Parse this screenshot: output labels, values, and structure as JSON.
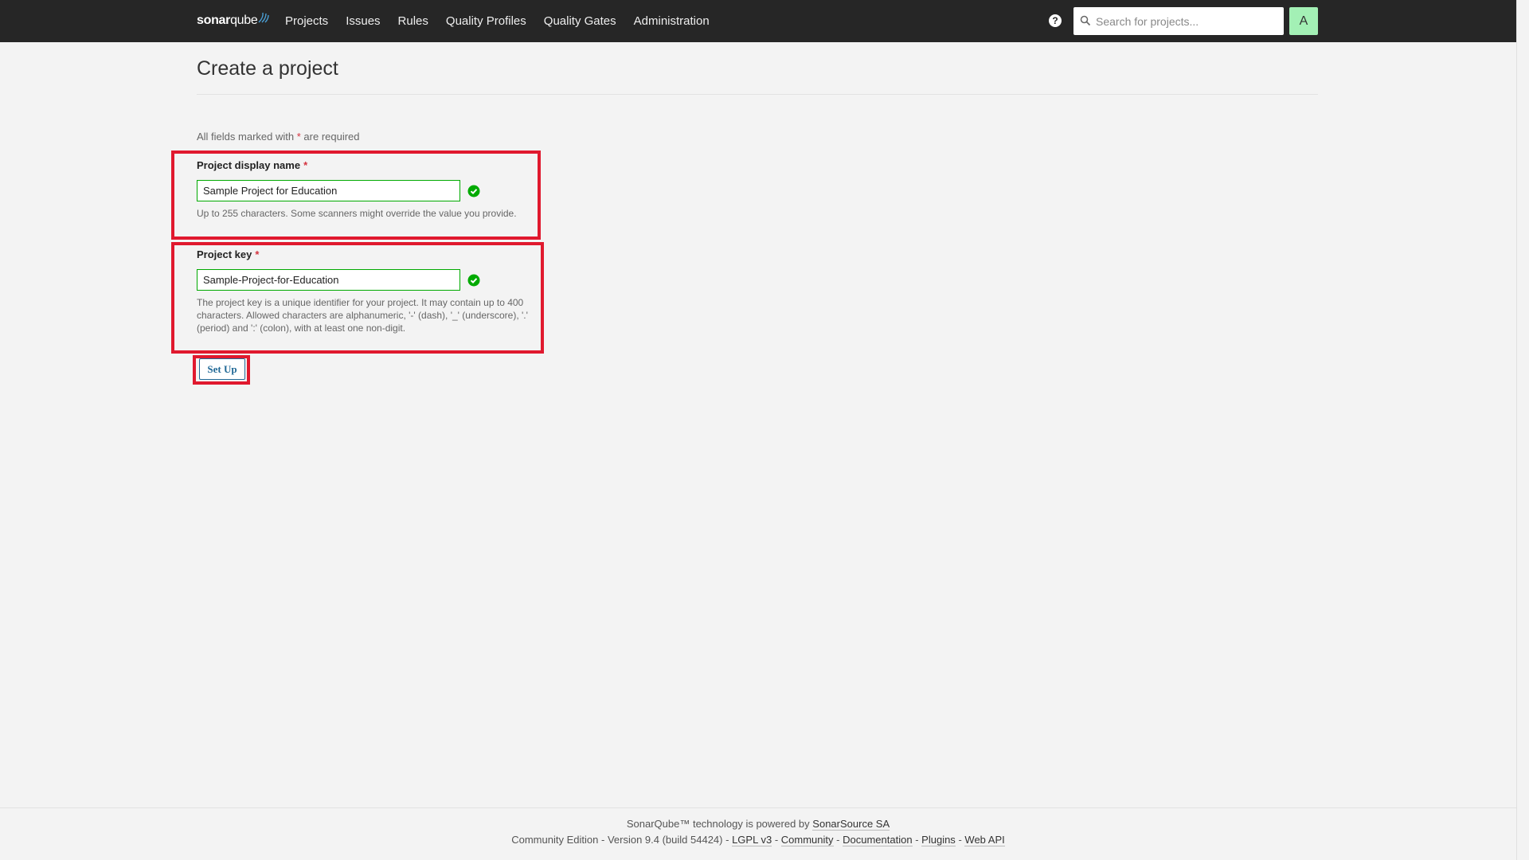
{
  "header": {
    "logo": {
      "bold": "sonar",
      "regular": "qube"
    },
    "nav": [
      "Projects",
      "Issues",
      "Rules",
      "Quality Profiles",
      "Quality Gates",
      "Administration"
    ],
    "help_glyph": "?",
    "search_placeholder": "Search for projects...",
    "avatar_letter": "A",
    "avatar_color": "#a3f0b5"
  },
  "page": {
    "title": "Create a project",
    "required_note_prefix": "All fields marked with",
    "required_star": "*",
    "required_note_suffix": "are required"
  },
  "form": {
    "display_name": {
      "label": "Project display name",
      "value": "Sample Project for Education",
      "help": "Up to 255 characters. Some scanners might override the value you provide.",
      "status_icon": "check-circle-icon"
    },
    "key": {
      "label": "Project key",
      "value": "Sample-Project-for-Education",
      "help": "The project key is a unique identifier for your project. It may contain up to 400 characters. Allowed characters are alphanumeric, '-' (dash), '_' (underscore), '.' (period) and ':' (colon), with at least one non-digit.",
      "status_icon": "check-circle-icon"
    },
    "submit_label": "Set Up"
  },
  "footer": {
    "line1_text": "SonarQube™ technology is powered by",
    "line1_link": "SonarSource SA",
    "edition": "Community Edition",
    "version": "Version 9.4 (build 54424)",
    "links": [
      "LGPL v3",
      "Community",
      "Documentation",
      "Plugins",
      "Web API"
    ],
    "separator": "-"
  },
  "colors": {
    "topbar": "#262626",
    "highlight": "#e0192e",
    "valid": "#00aa00",
    "required": "#d4333f",
    "button": "#236a97"
  }
}
